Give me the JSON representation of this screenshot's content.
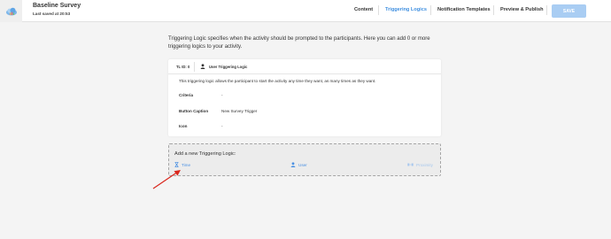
{
  "header": {
    "survey_title": "Baseline Survey",
    "last_saved": "Last saved at 20:53",
    "nav": [
      "Content",
      "Triggering Logics",
      "Notification Templates",
      "Preview & Publish"
    ],
    "active_nav": "Triggering Logics",
    "save_label": "SAVE",
    "accent_color": "#3f8fe0"
  },
  "intro_text": "Triggering Logic specifies when the activity should be prompted to the participants. Here you can add 0 or more triggering logics to your activity.",
  "card": {
    "id_label": "TL ID: 0",
    "type_label": "User Triggering Logic",
    "type_icon": "user-icon",
    "description": "This triggering logic allows the participant to start the activity any time they want, as many times as they want.",
    "rows": [
      {
        "label": "Criteria",
        "value": "-"
      },
      {
        "label": "Button Caption",
        "value": "New Survey Trigger"
      },
      {
        "label": "Icon",
        "value": "-"
      }
    ]
  },
  "add_section": {
    "title": "Add a new Triggering Logic:",
    "options": [
      {
        "label": "Time",
        "icon": "hourglass-icon",
        "enabled": true
      },
      {
        "label": "User",
        "icon": "user-icon",
        "enabled": true
      },
      {
        "label": "Proximity",
        "icon": "proximity-icon",
        "enabled": false
      }
    ]
  },
  "annotation_arrow_color": "#d9261c"
}
